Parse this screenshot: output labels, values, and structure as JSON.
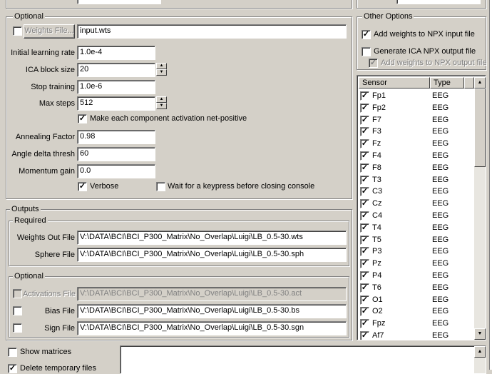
{
  "optional": {
    "legend": "Optional",
    "weights_button": "Weights File...",
    "weights_value": "input.wts",
    "initial_learning_rate_label": "Initial learning rate",
    "initial_learning_rate": "1.0e-4",
    "ica_block_size_label": "ICA block size",
    "ica_block_size": "20",
    "stop_training_label": "Stop training",
    "stop_training": "1.0e-6",
    "max_steps_label": "Max steps",
    "max_steps": "512",
    "net_positive_label": "Make each component activation net-positive",
    "annealing_factor_label": "Annealing Factor",
    "annealing_factor": "0.98",
    "angle_delta_label": "Angle delta thresh",
    "angle_delta": "60",
    "momentum_gain_label": "Momentum gain",
    "momentum_gain": "0.0",
    "verbose_label": "Verbose",
    "wait_keypress_label": "Wait for a keypress before closing console"
  },
  "outputs": {
    "legend": "Outputs",
    "required_legend": "Required",
    "weights_out_label": "Weights Out File",
    "weights_out": "V:\\DATA\\BCI\\BCI_P300_Matrix\\No_Overlap\\Luigi\\LB_0.5-30.wts",
    "sphere_label": "Sphere File",
    "sphere": "V:\\DATA\\BCI\\BCI_P300_Matrix\\No_Overlap\\Luigi\\LB_0.5-30.sph",
    "optional_legend": "Optional",
    "activations_label": "Activations File",
    "activations": "V:\\DATA\\BCI\\BCI_P300_Matrix\\No_Overlap\\Luigi\\LB_0.5-30.act",
    "bias_label": "Bias File",
    "bias": "V:\\DATA\\BCI\\BCI_P300_Matrix\\No_Overlap\\Luigi\\LB_0.5-30.bs",
    "sign_label": "Sign File",
    "sign": "V:\\DATA\\BCI\\BCI_P300_Matrix\\No_Overlap\\Luigi\\LB_0.5-30.sgn"
  },
  "bottom": {
    "show_matrices_label": "Show matrices",
    "delete_temp_label": "Delete temporary files"
  },
  "other_options": {
    "legend": "Other Options",
    "add_weights_label": "Add weights to NPX input file",
    "generate_ica_label": "Generate ICA NPX output file",
    "add_weights_output_label": "Add weights to NPX output file"
  },
  "sensors": {
    "col_sensor": "Sensor",
    "col_type": "Type",
    "rows": [
      {
        "name": "Fp1",
        "type": "EEG"
      },
      {
        "name": "Fp2",
        "type": "EEG"
      },
      {
        "name": "F7",
        "type": "EEG"
      },
      {
        "name": "F3",
        "type": "EEG"
      },
      {
        "name": "Fz",
        "type": "EEG"
      },
      {
        "name": "F4",
        "type": "EEG"
      },
      {
        "name": "F8",
        "type": "EEG"
      },
      {
        "name": "T3",
        "type": "EEG"
      },
      {
        "name": "C3",
        "type": "EEG"
      },
      {
        "name": "Cz",
        "type": "EEG"
      },
      {
        "name": "C4",
        "type": "EEG"
      },
      {
        "name": "T4",
        "type": "EEG"
      },
      {
        "name": "T5",
        "type": "EEG"
      },
      {
        "name": "P3",
        "type": "EEG"
      },
      {
        "name": "Pz",
        "type": "EEG"
      },
      {
        "name": "P4",
        "type": "EEG"
      },
      {
        "name": "T6",
        "type": "EEG"
      },
      {
        "name": "O1",
        "type": "EEG"
      },
      {
        "name": "O2",
        "type": "EEG"
      },
      {
        "name": "Fpz",
        "type": "EEG"
      },
      {
        "name": "Af7",
        "type": "EEG"
      }
    ]
  },
  "check_glyph": "✓"
}
